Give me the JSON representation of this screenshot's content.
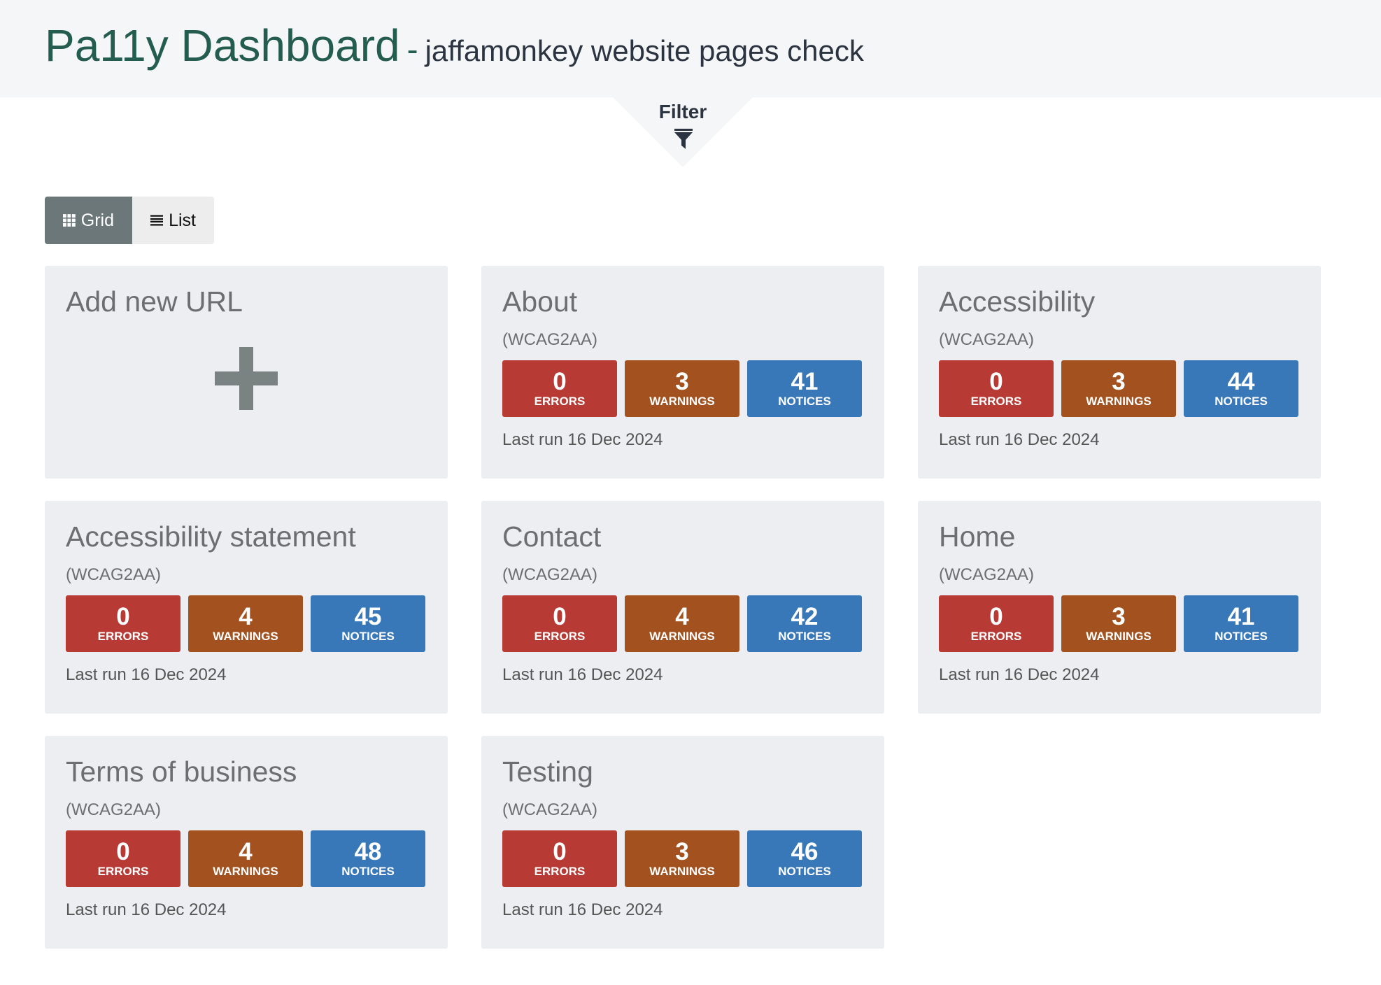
{
  "header": {
    "title": "Pa11y Dashboard",
    "separator": "-",
    "subtitle": "jaffamonkey website pages check"
  },
  "filter": {
    "label": "Filter",
    "icon": "filter-icon"
  },
  "view_toggle": {
    "grid_label": "Grid",
    "list_label": "List",
    "active": "Grid"
  },
  "add_card": {
    "title": "Add new URL",
    "icon": "plus-icon"
  },
  "labels": {
    "errors": "ERRORS",
    "warnings": "WARNINGS",
    "notices": "NOTICES"
  },
  "cards": [
    {
      "title": "About",
      "standard": "(WCAG2AA)",
      "errors": "0",
      "warnings": "3",
      "notices": "41",
      "last_run": "Last run 16 Dec 2024"
    },
    {
      "title": "Accessibility",
      "standard": "(WCAG2AA)",
      "errors": "0",
      "warnings": "3",
      "notices": "44",
      "last_run": "Last run 16 Dec 2024"
    },
    {
      "title": "Accessibility statement",
      "standard": "(WCAG2AA)",
      "errors": "0",
      "warnings": "4",
      "notices": "45",
      "last_run": "Last run 16 Dec 2024"
    },
    {
      "title": "Contact",
      "standard": "(WCAG2AA)",
      "errors": "0",
      "warnings": "4",
      "notices": "42",
      "last_run": "Last run 16 Dec 2024"
    },
    {
      "title": "Home",
      "standard": "(WCAG2AA)",
      "errors": "0",
      "warnings": "3",
      "notices": "41",
      "last_run": "Last run 16 Dec 2024"
    },
    {
      "title": "Terms of business",
      "standard": "(WCAG2AA)",
      "errors": "0",
      "warnings": "4",
      "notices": "48",
      "last_run": "Last run 16 Dec 2024"
    },
    {
      "title": "Testing",
      "standard": "(WCAG2AA)",
      "errors": "0",
      "warnings": "3",
      "notices": "46",
      "last_run": "Last run 16 Dec 2024"
    }
  ],
  "colors": {
    "brand": "#245c4f",
    "errors": "#b83a35",
    "warnings": "#a3511f",
    "notices": "#3878b8",
    "card_bg": "#eceef1"
  }
}
